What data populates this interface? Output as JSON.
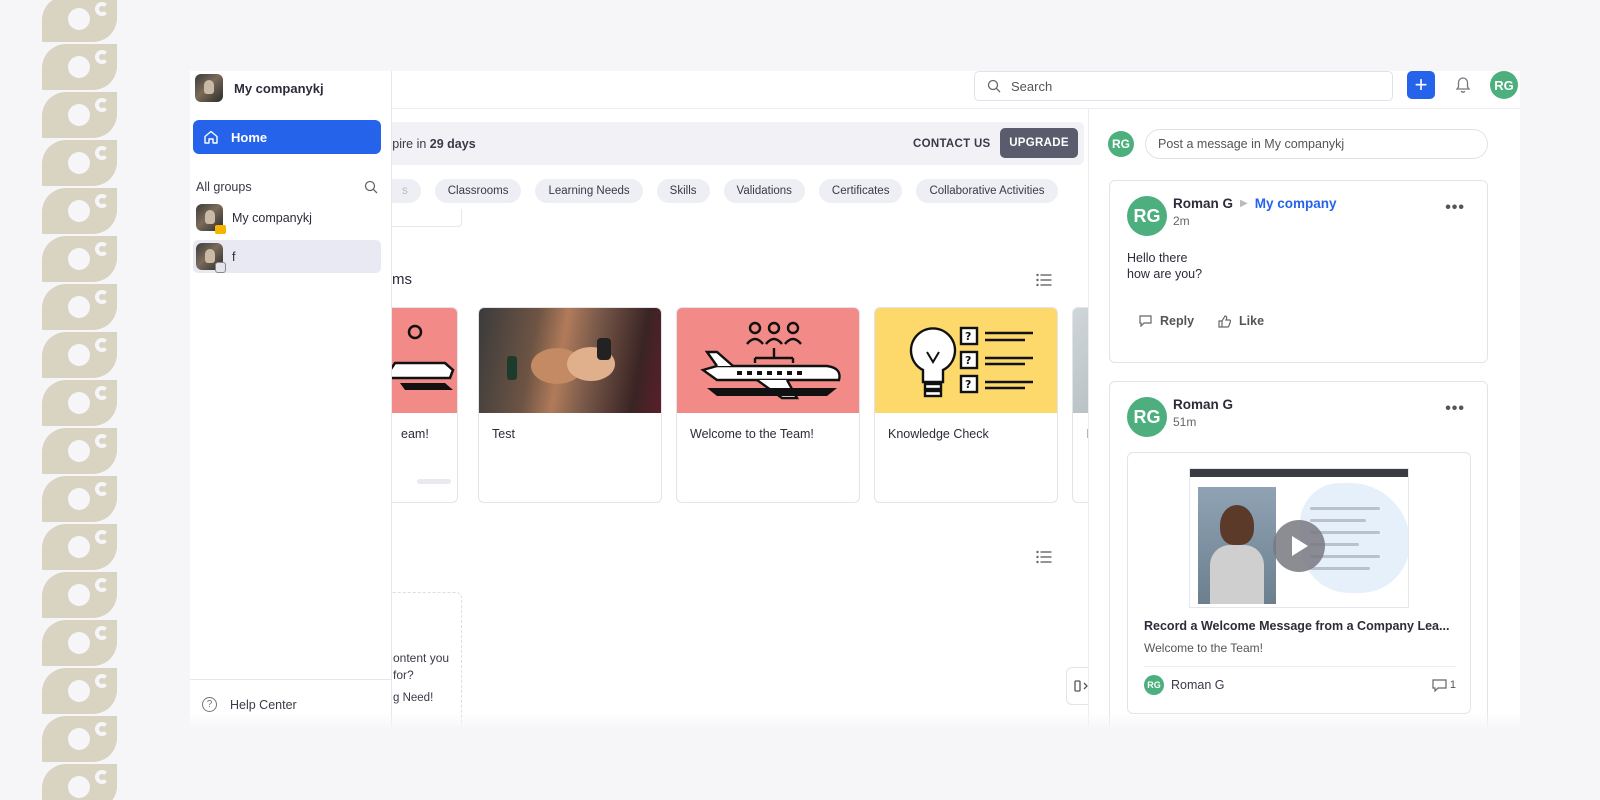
{
  "org": {
    "name": "My companykj"
  },
  "nav": {
    "home_label": "Home"
  },
  "groups": {
    "heading": "All groups",
    "items": [
      {
        "label": "My companykj"
      },
      {
        "label": "f"
      }
    ]
  },
  "help": {
    "label": "Help Center"
  },
  "topbar": {
    "search_placeholder": "Search",
    "plus_label": "+",
    "user_initials": "RG"
  },
  "trial": {
    "text_prefix": "xpire in ",
    "days": "29 days",
    "contact_label": "CONTACT US",
    "upgrade_label": "UPGRADE"
  },
  "chips": {
    "faded": "s",
    "items": [
      "Classrooms",
      "Learning Needs",
      "Skills",
      "Validations",
      "Certificates",
      "Collaborative Activities"
    ]
  },
  "sections": {
    "programs_title_partial": "ms"
  },
  "cards": [
    {
      "title": "eam!",
      "image": "airplane-team-illustration"
    },
    {
      "title": "Test",
      "image": "fist-bump-photo"
    },
    {
      "title": "Welcome to the Team!",
      "image": "airplane-team-illustration"
    },
    {
      "title": "Knowledge Check",
      "image": "lightbulb-checklist-illustration"
    },
    {
      "title": "In",
      "image": "partial-photo"
    }
  ],
  "empty_card": {
    "line1": "ontent you",
    "line2": "for?",
    "line3": "g Need!"
  },
  "feed": {
    "composer_initials": "RG",
    "composer_placeholder": "Post a message in My companykj",
    "posts": [
      {
        "initials": "RG",
        "author": "Roman G",
        "group": "My company",
        "time": "2m",
        "body_line1": "Hello there",
        "body_line2": "how are you?",
        "reply_label": "Reply",
        "like_label": "Like"
      },
      {
        "initials": "RG",
        "author": "Roman G",
        "time": "51m",
        "attachment": {
          "title": "Record a Welcome Message from a Company Lea...",
          "subtitle": "Welcome to the Team!",
          "owner_initials": "RG",
          "owner": "Roman G",
          "comments": "1"
        }
      }
    ]
  },
  "colors": {
    "accent": "#2563eb",
    "avatar_green": "#4caf7d",
    "card_red": "#f28b87",
    "card_yellow": "#fcd96a",
    "upgrade_bg": "#5a5c6e"
  }
}
